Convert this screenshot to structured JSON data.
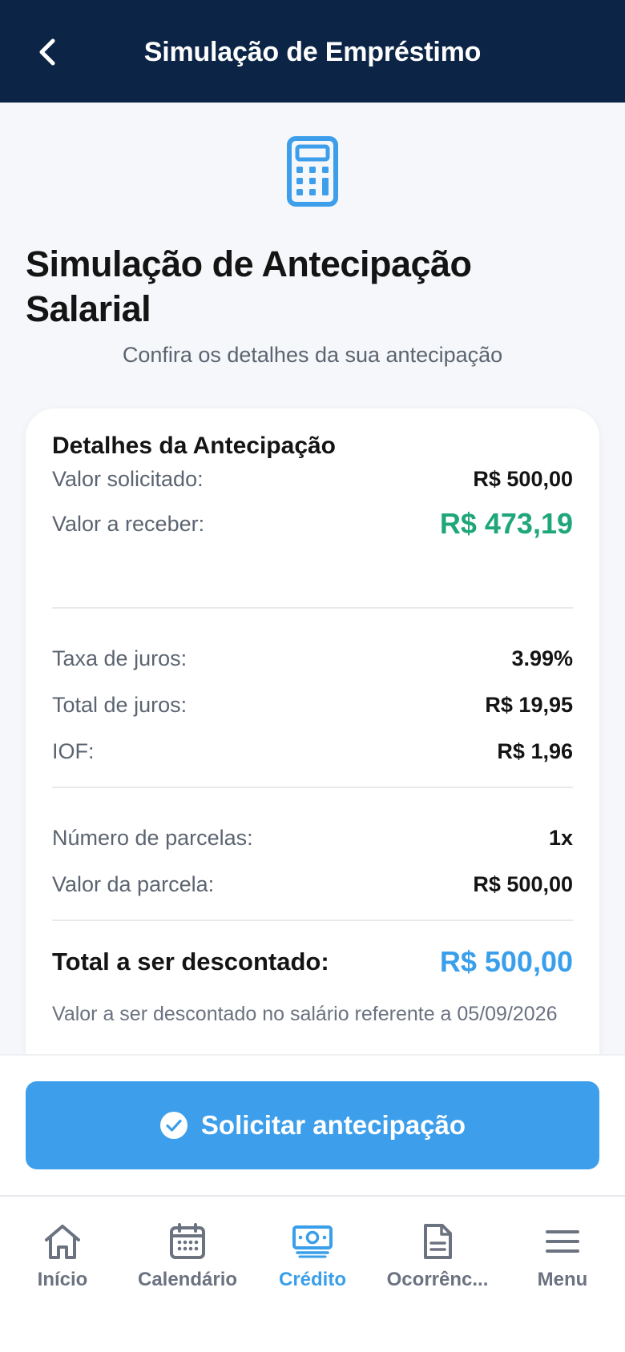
{
  "header": {
    "title": "Simulação de Empréstimo",
    "back_icon": "chevron-left-icon"
  },
  "hero": {
    "icon": "calculator-icon"
  },
  "page": {
    "title": "Simulação de Antecipação Salarial",
    "subtitle": "Confira os detalhes da sua antecipação"
  },
  "details": {
    "title": "Detalhes da Antecipação",
    "rows": [
      {
        "label": "Valor solicitado:",
        "value": "R$ 500,00"
      },
      {
        "label": "Valor a receber:",
        "value": "R$ 473,19"
      },
      {
        "label": "Taxa de juros:",
        "value": "3.99%"
      },
      {
        "label": "Total de juros:",
        "value": "R$ 19,95"
      },
      {
        "label": "IOF:",
        "value": "R$ 1,96"
      },
      {
        "label": "Número de parcelas:",
        "value": "1x"
      },
      {
        "label": "Valor da parcela:",
        "value": "R$ 500,00"
      }
    ],
    "total": {
      "label": "Total a ser descontado:",
      "value": "R$ 500,00"
    },
    "note": "Valor a ser descontado no salário referente a 05/09/2026"
  },
  "action": {
    "label": "Solicitar antecipação",
    "icon": "check-circle-icon"
  },
  "tabbar": {
    "active": "Crédito",
    "items": [
      {
        "label": "Início",
        "icon": "home-icon"
      },
      {
        "label": "Calendário",
        "icon": "calendar-icon"
      },
      {
        "label": "Crédito",
        "icon": "banknote-icon"
      },
      {
        "label": "Ocorrênc...",
        "icon": "document-icon"
      },
      {
        "label": "Menu",
        "icon": "menu-icon"
      }
    ]
  },
  "colors": {
    "header_bg": "#0c2546",
    "accent_blue": "#3d9feb",
    "positive_green": "#1fa67a",
    "muted_text": "#5b6470"
  }
}
